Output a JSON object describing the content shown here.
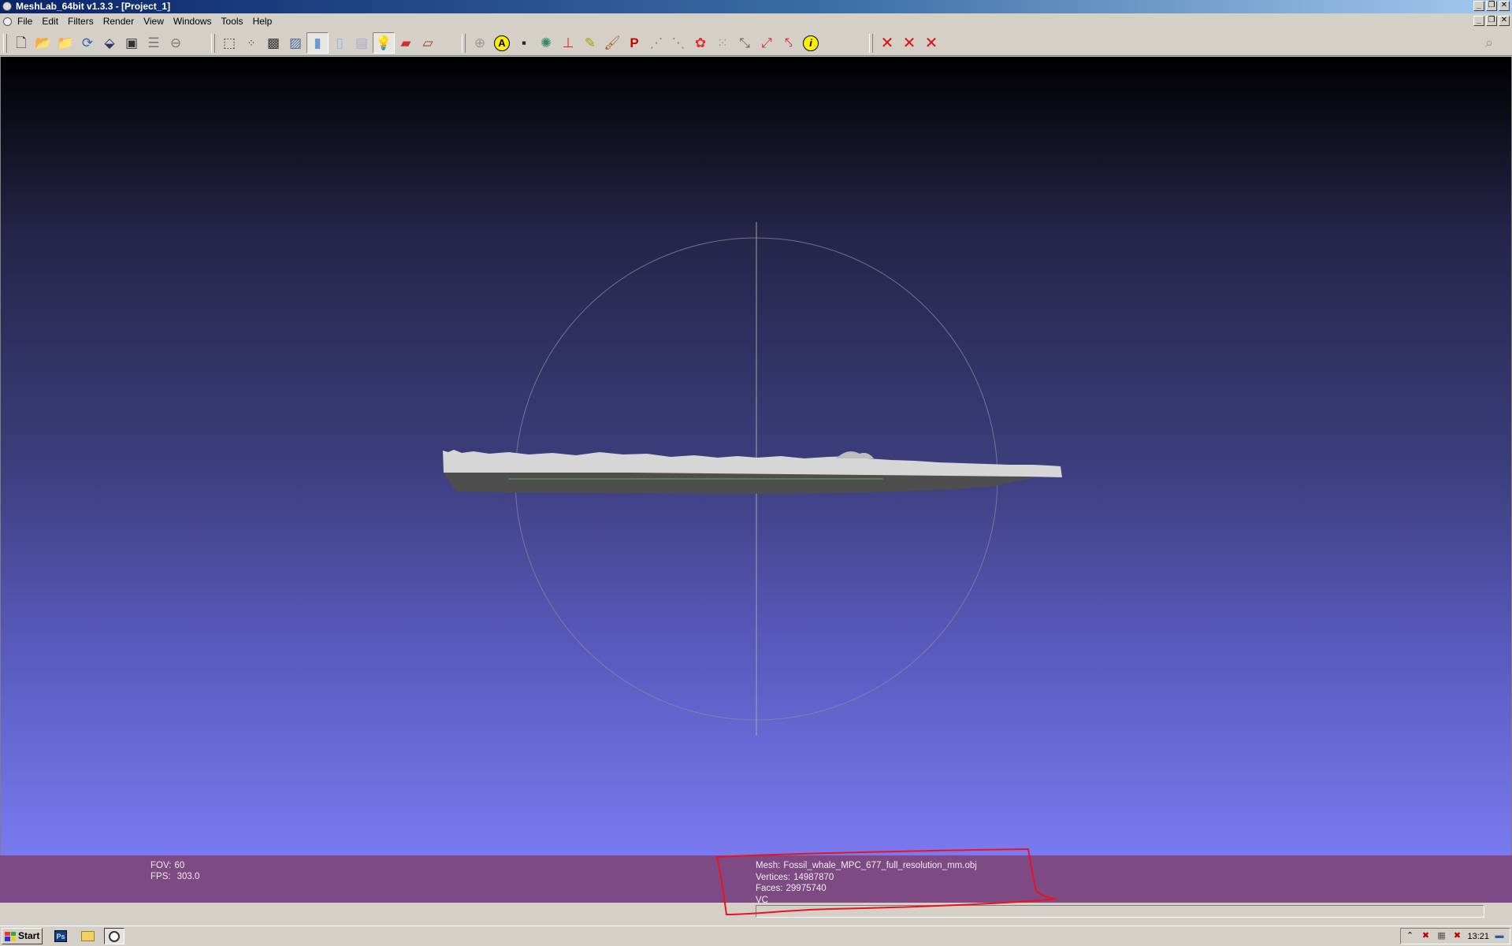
{
  "window": {
    "title": "MeshLab_64bit v1.3.3 - [Project_1]",
    "buttons": [
      "minimize",
      "restore",
      "close"
    ]
  },
  "menubar": {
    "items": [
      "File",
      "Edit",
      "Filters",
      "Render",
      "View",
      "Windows",
      "Tools",
      "Help"
    ],
    "doc_buttons": [
      "minimize",
      "restore",
      "close"
    ]
  },
  "toolbar": {
    "groups": [
      [
        "new-document-icon",
        "open-folder-icon",
        "open-project-icon",
        "reload-icon",
        "save-icon",
        "snapshot-icon",
        "layers-icon",
        "import-raster-icon"
      ],
      [
        "bounding-box-icon",
        "points-icon",
        "wireframe-icon",
        "hidden-lines-icon",
        "flat-shading-icon",
        "smooth-shading-icon",
        "texture-icon",
        "lighting-icon",
        "fancy-lighting-icon",
        "backface-icon"
      ],
      [
        "trackball-icon",
        "annotation-icon",
        "raster-icon",
        "vertex-color-icon",
        "axis-icon",
        "paint-icon",
        "brush-icon",
        "align-icon",
        "select-faces-icon",
        "select-vertices-icon",
        "quality-icon",
        "reference-icon",
        "measure-icon",
        "manual-align-icon",
        "pick-points-icon",
        "info-icon"
      ],
      [
        "delete-icon",
        "delete-faces-icon",
        "delete-vertices-icon"
      ]
    ],
    "active": [
      "flat-shading-icon",
      "lighting-icon"
    ]
  },
  "colors": {
    "viewport_top": "#000000",
    "viewport_bottom": "#7a7af0",
    "info_bar": "#7e4a84",
    "annotation_stroke": "#e8141e"
  },
  "viewport": {
    "fov_label": "FOV:",
    "fov_value": "60",
    "fps_label": "FPS:",
    "fps_value": "303.0",
    "mesh_label": "Mesh:",
    "mesh_value": "Fossil_whale_MPC_677_full_resolution_mm.obj",
    "vertices_label": "Vertices:",
    "vertices_value": "14987870",
    "faces_label": "Faces:",
    "faces_value": "29975740",
    "extra": "VC"
  },
  "taskbar": {
    "start_label": "Start",
    "quick_launch": [
      "photoshop-icon",
      "folder-icon",
      "meshlab-icon"
    ],
    "tray_icons": [
      "expand-tray-icon",
      "network-icon",
      "display-icon",
      "volume-icon",
      "security-icon"
    ],
    "clock": "13:21"
  }
}
